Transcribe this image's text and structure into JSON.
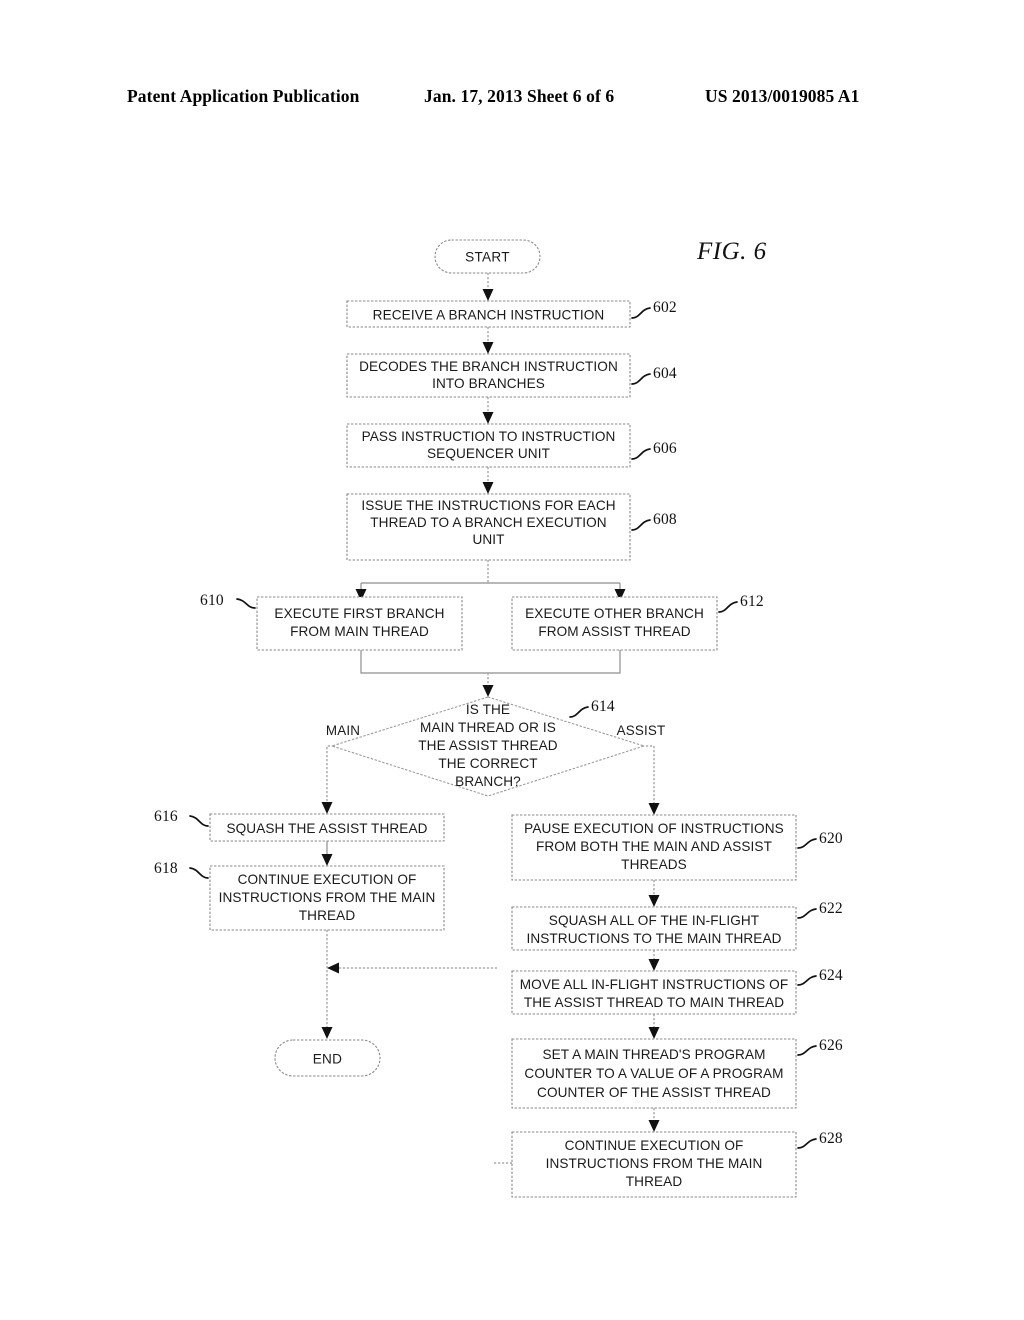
{
  "header": {
    "left": "Patent Application Publication",
    "middle": "Jan. 17, 2013  Sheet 6 of 6",
    "right": "US 2013/0019085 A1"
  },
  "figure": {
    "label": "FIG. 6"
  },
  "flowchart": {
    "start_label": "START",
    "end_label": "END",
    "edge_labels": {
      "main": "MAIN",
      "assist": "ASSIST"
    },
    "nodes": [
      {
        "ref": "602",
        "lines": [
          "RECEIVE A BRANCH INSTRUCTION"
        ]
      },
      {
        "ref": "604",
        "lines": [
          "DECODES THE BRANCH INSTRUCTION",
          "INTO BRANCHES"
        ]
      },
      {
        "ref": "606",
        "lines": [
          "PASS INSTRUCTION TO INSTRUCTION",
          "SEQUENCER UNIT"
        ]
      },
      {
        "ref": "608",
        "lines": [
          "ISSUE THE INSTRUCTIONS FOR EACH",
          "THREAD TO A BRANCH EXECUTION",
          "UNIT"
        ]
      },
      {
        "ref": "610",
        "lines": [
          "EXECUTE FIRST BRANCH",
          "FROM MAIN THREAD"
        ]
      },
      {
        "ref": "612",
        "lines": [
          "EXECUTE OTHER BRANCH",
          "FROM ASSIST THREAD"
        ]
      },
      {
        "ref": "614",
        "lines": [
          "IS THE",
          "MAIN THREAD OR IS",
          "THE ASSIST THREAD",
          "THE CORRECT",
          "BRANCH?"
        ]
      },
      {
        "ref": "616",
        "lines": [
          "SQUASH THE ASSIST THREAD"
        ]
      },
      {
        "ref": "618",
        "lines": [
          "CONTINUE EXECUTION OF",
          "INSTRUCTIONS FROM THE MAIN",
          "THREAD"
        ]
      },
      {
        "ref": "620",
        "lines": [
          "PAUSE EXECUTION OF INSTRUCTIONS",
          "FROM BOTH THE MAIN AND ASSIST",
          "THREADS"
        ]
      },
      {
        "ref": "622",
        "lines": [
          "SQUASH ALL OF THE IN-FLIGHT",
          "INSTRUCTIONS TO THE MAIN THREAD"
        ]
      },
      {
        "ref": "624",
        "lines": [
          "MOVE ALL IN-FLIGHT INSTRUCTIONS OF",
          "THE ASSIST THREAD TO MAIN THREAD"
        ]
      },
      {
        "ref": "626",
        "lines": [
          "SET A MAIN THREAD'S PROGRAM",
          "COUNTER TO A VALUE OF A PROGRAM",
          "COUNTER OF THE ASSIST THREAD"
        ]
      },
      {
        "ref": "628",
        "lines": [
          "CONTINUE EXECUTION OF",
          "INSTRUCTIONS FROM THE MAIN",
          "THREAD"
        ]
      }
    ]
  }
}
